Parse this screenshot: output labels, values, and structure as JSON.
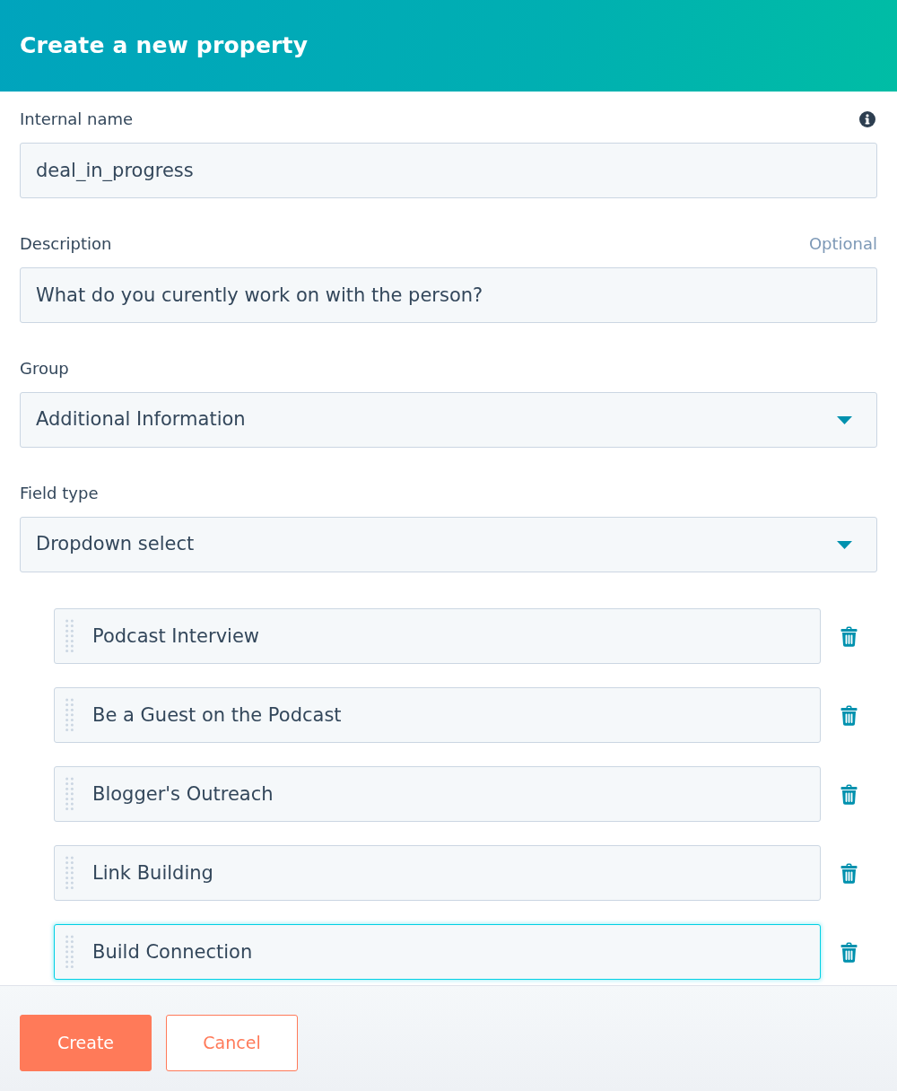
{
  "header": {
    "title": "Create a new property"
  },
  "fields": [
    {
      "kind": "text",
      "label": "Internal name",
      "info": true,
      "value": "deal_in_progress"
    },
    {
      "kind": "text",
      "label": "Description",
      "optional_note": "Optional",
      "value": "What do you curently work on with the person?"
    },
    {
      "kind": "select",
      "label": "Group",
      "value": "Additional Information"
    },
    {
      "kind": "select",
      "label": "Field type",
      "value": "Dropdown select"
    }
  ],
  "options": [
    {
      "value": "Podcast Interview",
      "focused": false
    },
    {
      "value": "Be a Guest on the Podcast",
      "focused": false
    },
    {
      "value": "Blogger's Outreach",
      "focused": false
    },
    {
      "value": "Link Building",
      "focused": false
    },
    {
      "value": "Build Connection",
      "focused": true
    }
  ],
  "buttons": [
    {
      "kind": "primary",
      "label": "Create"
    },
    {
      "kind": "secondary",
      "label": "Cancel"
    }
  ]
}
